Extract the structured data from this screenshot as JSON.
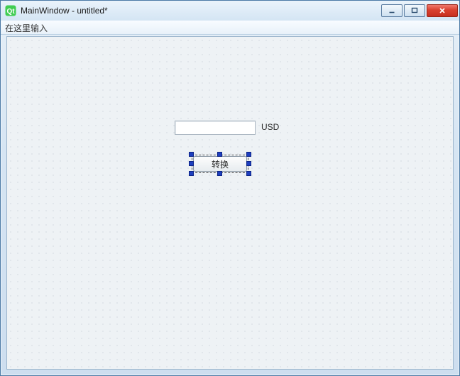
{
  "window": {
    "title": "MainWindow - untitled*",
    "app_icon": "qt-logo-icon"
  },
  "titlebar_buttons": {
    "minimize_label": "Minimize",
    "maximize_label": "Maximize",
    "close_label": "Close"
  },
  "menubar": {
    "placeholder": "在这里输入"
  },
  "form": {
    "amount_input": {
      "value": "",
      "placeholder": ""
    },
    "currency_label": "USD",
    "convert_button_label": "转换"
  },
  "designer": {
    "selected_widget": "convert-button"
  }
}
